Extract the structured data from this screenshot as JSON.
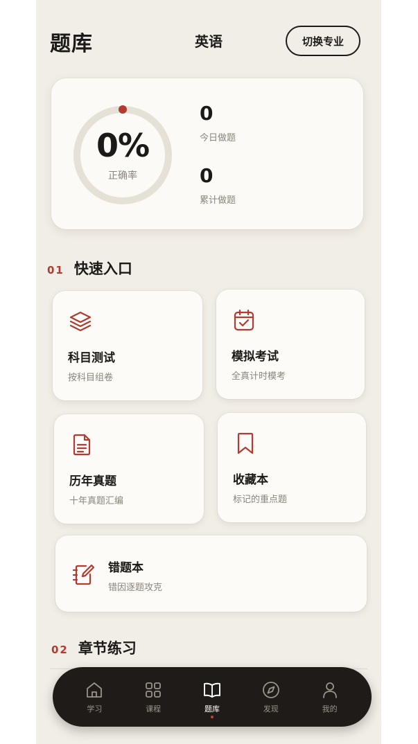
{
  "header": {
    "title": "题库",
    "subject": "英语",
    "switch_label": "切换专业"
  },
  "stats": {
    "accuracy_percent": 0,
    "accuracy_display": "0%",
    "accuracy_label": "正确率",
    "today_value": "0",
    "today_label": "今日做题",
    "total_value": "0",
    "total_label": "累计做题"
  },
  "sections": {
    "quick": {
      "number": "01",
      "title": "快速入口"
    },
    "chapter": {
      "number": "02",
      "title": "章节练习"
    }
  },
  "quick_entries": [
    {
      "title": "科目测试",
      "subtitle": "按科目组卷",
      "icon": "layers-icon"
    },
    {
      "title": "模拟考试",
      "subtitle": "全真计时模考",
      "icon": "calendar-check-icon"
    },
    {
      "title": "历年真题",
      "subtitle": "十年真题汇编",
      "icon": "document-icon"
    },
    {
      "title": "收藏本",
      "subtitle": "标记的重点题",
      "icon": "bookmark-icon"
    },
    {
      "title": "错题本",
      "subtitle": "错因逐题攻克",
      "icon": "notebook-pen-icon"
    }
  ],
  "tabbar": {
    "items": [
      {
        "label": "学习",
        "icon": "home-icon",
        "active": false
      },
      {
        "label": "课程",
        "icon": "grid-icon",
        "active": false
      },
      {
        "label": "题库",
        "icon": "book-open-icon",
        "active": true
      },
      {
        "label": "发现",
        "icon": "compass-icon",
        "active": false
      },
      {
        "label": "我的",
        "icon": "user-icon",
        "active": false
      }
    ]
  },
  "colors": {
    "accent": "#b23a2e",
    "background": "#f1eee7",
    "card": "#fbfaf6",
    "tabbar": "#1f1b18",
    "ring_track": "#e6e1d6"
  }
}
